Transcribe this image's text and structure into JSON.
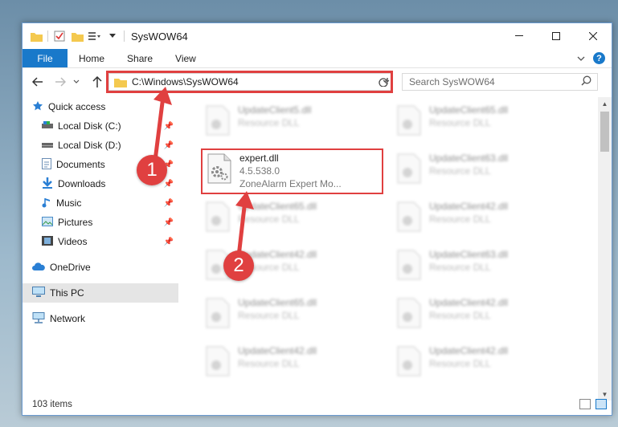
{
  "window": {
    "title": "SysWOW64"
  },
  "ribbon": {
    "tabs": [
      "File",
      "Home",
      "Share",
      "View"
    ],
    "help": "?"
  },
  "address": {
    "path": "C:\\Windows\\SysWOW64",
    "search_placeholder": "Search SysWOW64"
  },
  "sidebar": {
    "quick_access": "Quick access",
    "items": [
      {
        "label": "Local Disk (C:)",
        "icon": "drive-icon"
      },
      {
        "label": "Local Disk (D:)",
        "icon": "drive-icon"
      },
      {
        "label": "Documents",
        "icon": "documents-icon"
      },
      {
        "label": "Downloads",
        "icon": "downloads-icon"
      },
      {
        "label": "Music",
        "icon": "music-icon"
      },
      {
        "label": "Pictures",
        "icon": "pictures-icon"
      },
      {
        "label": "Videos",
        "icon": "videos-icon"
      }
    ],
    "onedrive": "OneDrive",
    "this_pc": "This PC",
    "network": "Network"
  },
  "files": {
    "highlighted": {
      "name": "expert.dll",
      "version": "4.5.538.0",
      "description": "ZoneAlarm Expert Mo..."
    },
    "col1": [
      {
        "name": "UpdateClient5.dll",
        "type": "Resource DLL"
      },
      {
        "name": "UpdateClient65.dll",
        "type": "Resource DLL"
      },
      {
        "name": "UpdateClient42.dll",
        "type": "Resource DLL"
      },
      {
        "name": "UpdateClient65.dll",
        "type": "Resource DLL"
      },
      {
        "name": "UpdateClient42.dll",
        "type": "Resource DLL"
      }
    ],
    "col2": [
      {
        "name": "UpdateClient65.dll",
        "type": "Resource DLL"
      },
      {
        "name": "UpdateClient63.dll",
        "type": "Resource DLL"
      },
      {
        "name": "UpdateClient42.dll",
        "type": "Resource DLL"
      },
      {
        "name": "UpdateClient63.dll",
        "type": "Resource DLL"
      },
      {
        "name": "UpdateClient42.dll",
        "type": "Resource DLL"
      },
      {
        "name": "UpdateClient42.dll",
        "type": "Resource DLL"
      }
    ]
  },
  "status": {
    "count": "103 items"
  },
  "annotations": {
    "badge1": "1",
    "badge2": "2",
    "color": "#e04040"
  }
}
